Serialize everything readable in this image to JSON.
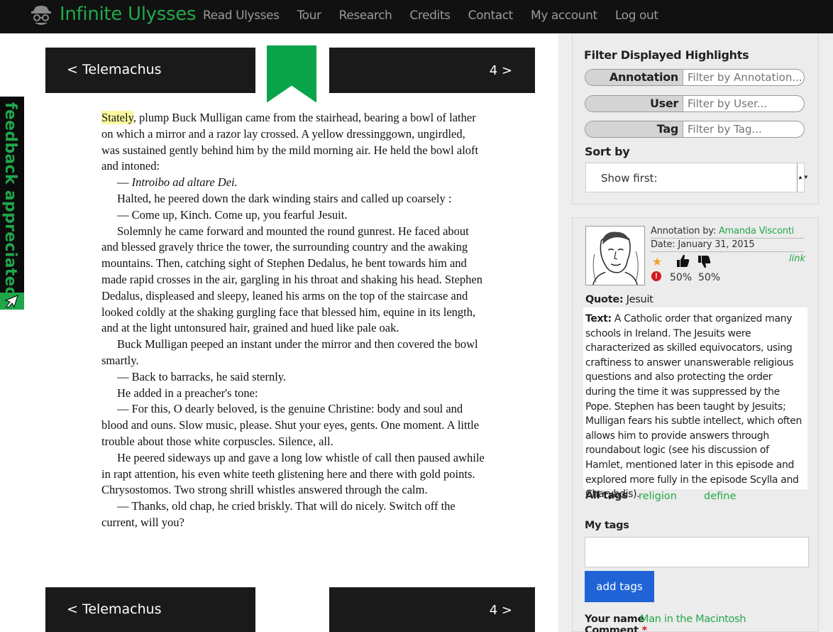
{
  "app": {
    "brand": "Infinite Ulysses",
    "nav": [
      "Read Ulysses",
      "Tour",
      "Research",
      "Credits",
      "Contact",
      "My account",
      "Log out"
    ]
  },
  "feedback": {
    "label": "feedback appreciated!"
  },
  "chapter": {
    "prev": "< Telemachus",
    "next": "4 >"
  },
  "text": {
    "highlight": "Stately",
    "para1_rest": ", plump Buck Mulligan came from the stairhead, bearing a bowl of lather on which a mirror and a razor lay crossed. A yellow dressinggown, ungirdled, was sustained gently behind him by the mild morning air. He held the bowl aloft and intoned:",
    "intro_dash": "— ",
    "intro_ital": "Introibo ad altare Dei.",
    "lines": [
      "Halted, he peered down the dark winding stairs and called up coarsely :",
      "— Come up, Kinch. Come up, you fearful Jesuit.",
      "Solemnly he came forward and mounted the round gunrest. He faced about and blessed gravely thrice the tower, the surrounding country and the awaking mountains. Then, catching sight of Stephen Dedalus, he bent towards him and made rapid crosses in the air, gargling in his throat and shaking his head. Stephen Dedalus, displeased and sleepy, leaned his arms on the top of the staircase and looked coldly at the shaking gurgling face that blessed him, equine in its length, and at the light untonsured hair, grained and hued like pale oak.",
      "Buck Mulligan peeped an instant under the mirror and then covered the bowl smartly.",
      "— Back to barracks, he said sternly.",
      "He added in a preacher's tone:",
      "— For this, O dearly beloved, is the genuine Christine: body and soul and blood and ouns. Slow music, please. Shut your eyes, gents. One moment. A little trouble about those white corpuscles. Silence, all.",
      "He peered sideways up and gave a long low whistle of call then paused awhile in rapt attention, his even white teeth glistening here and there with gold points. Chrysostomos. Two strong shrill whistles answered through the calm.",
      "— Thanks, old chap, he cried briskly. That will do nicely. Switch off the current, will you?"
    ]
  },
  "filter": {
    "heading": "Filter Displayed Highlights",
    "annotation_label": "Annotation",
    "annotation_placeholder": "Filter by Annotation...",
    "user_label": "User",
    "user_placeholder": "Filter by User...",
    "tag_label": "Tag",
    "tag_placeholder": "Filter by Tag...",
    "sort_heading": "Sort by",
    "sort_value": "Show first:"
  },
  "annotation": {
    "by_label": "Annotation by: ",
    "author": "Amanda Visconti",
    "date": "Date: January 31, 2015",
    "link": "link",
    "up_pct": "50%",
    "down_pct": "50%",
    "quote_label": "Quote:",
    "quote": "Jesuit",
    "text_label": "Text:",
    "text": "A Catholic order that organized many schools in Ireland. The Jesuits were characterized as skilled equivocators, using craftiness to answer unanswerable religious questions and also protecting the order during the time it was suppressed by the Pope. Stephen has been taught by Jesuits; Mulligan fears his subtle intellect, which often allows him to provide answers through roundabout logic (see his discussion of Hamlet, mentioned later in this episode and explored more fully in the episode Scylla and Charybdis).",
    "all_tags_label": "All tags",
    "tags": [
      "religion",
      "define"
    ],
    "my_tags_label": "My tags",
    "add_tags_button": "add tags",
    "your_name_label": "Your name",
    "your_name": "Man in the Macintosh",
    "comment_label": "Comment",
    "required_mark": "*"
  },
  "colors": {
    "brand_green": "#22a84a",
    "button_blue": "#1f63d6",
    "highlight_yellow": "#fbf8a0"
  }
}
